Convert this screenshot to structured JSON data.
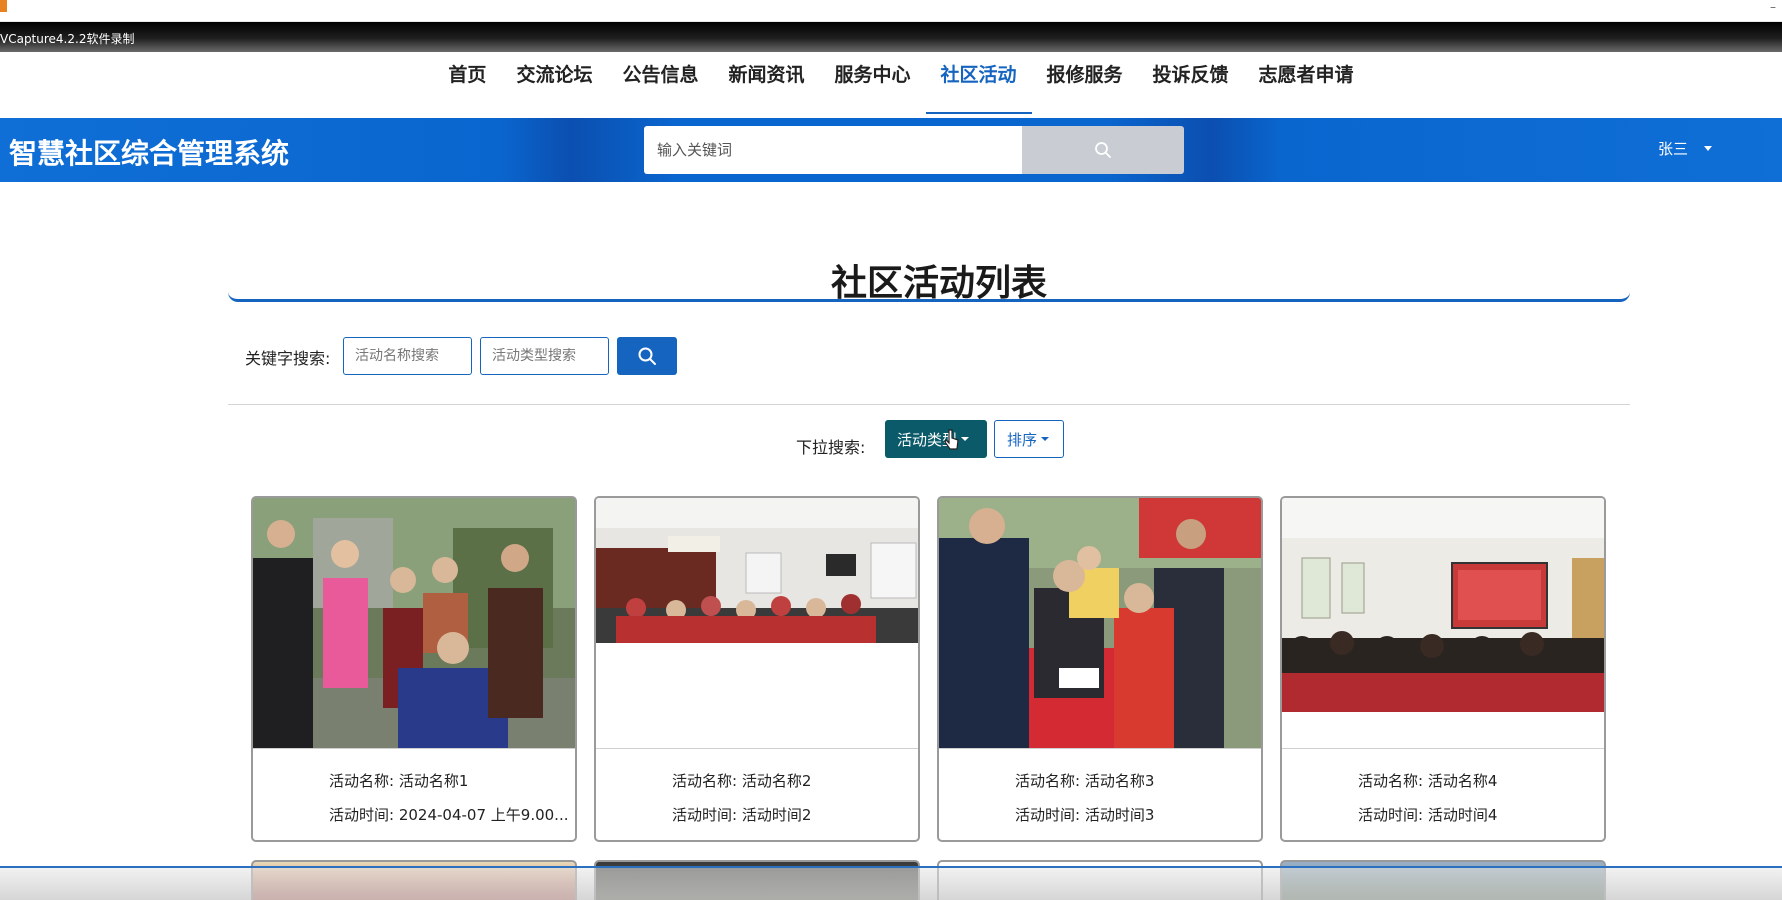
{
  "recorder": {
    "label": "VCapture4.2.2软件录制",
    "minimize": "–"
  },
  "nav": {
    "items": [
      {
        "label": "首页",
        "active": false
      },
      {
        "label": "交流论坛",
        "active": false
      },
      {
        "label": "公告信息",
        "active": false
      },
      {
        "label": "新闻资讯",
        "active": false
      },
      {
        "label": "服务中心",
        "active": false
      },
      {
        "label": "社区活动",
        "active": true
      },
      {
        "label": "报修服务",
        "active": false
      },
      {
        "label": "投诉反馈",
        "active": false
      },
      {
        "label": "志愿者申请",
        "active": false
      }
    ]
  },
  "header": {
    "site_title": "智慧社区综合管理系统",
    "search_placeholder": "输入关键词",
    "user_name": "张三"
  },
  "page": {
    "title": "社区活动列表"
  },
  "keyword_search": {
    "label": "关键字搜索:",
    "name_placeholder": "活动名称搜索",
    "type_placeholder": "活动类型搜索"
  },
  "dropdown_search": {
    "label": "下拉搜索:",
    "type_button": "活动类型",
    "sort_button": "排序"
  },
  "activities": [
    {
      "name_label": "活动名称:",
      "name": "活动名称1",
      "time_label": "活动时间:",
      "time": "2024-04-07 上午9.00..."
    },
    {
      "name_label": "活动名称:",
      "name": "活动名称2",
      "time_label": "活动时间:",
      "time": "活动时间2"
    },
    {
      "name_label": "活动名称:",
      "name": "活动名称3",
      "time_label": "活动时间:",
      "time": "活动时间3"
    },
    {
      "name_label": "活动名称:",
      "name": "活动名称4",
      "time_label": "活动时间:",
      "time": "活动时间4"
    }
  ],
  "colors": {
    "brand_blue": "#1565c0",
    "header_blue": "#0a66cf",
    "type_button": "#0a5a6a"
  },
  "icons": [
    "search-icon",
    "caret-down-icon",
    "cursor-icon"
  ]
}
